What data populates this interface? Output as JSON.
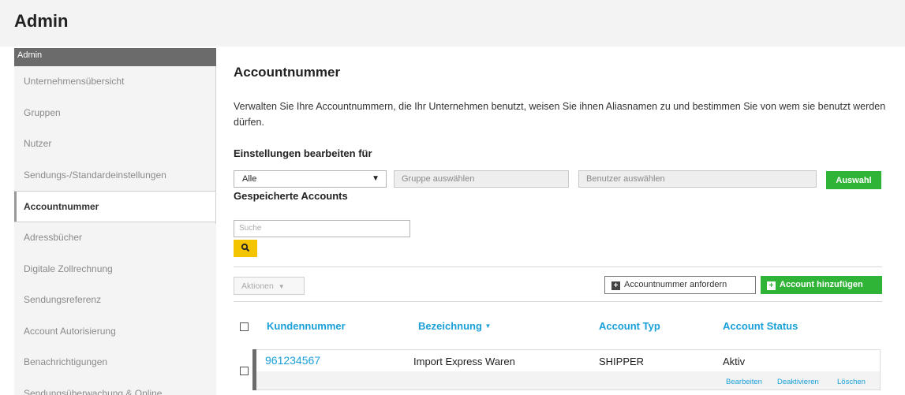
{
  "app": {
    "title": "Admin"
  },
  "sidebar": {
    "header": "Admin",
    "items": [
      {
        "label": "Unternehmensübersicht",
        "active": false
      },
      {
        "label": "Gruppen",
        "active": false
      },
      {
        "label": "Nutzer",
        "active": false
      },
      {
        "label": "Sendungs-/Standardeinstellungen",
        "active": false
      },
      {
        "label": "Accountnummer",
        "active": true
      },
      {
        "label": "Adressbücher",
        "active": false
      },
      {
        "label": "Digitale Zollrechnung",
        "active": false
      },
      {
        "label": "Sendungsreferenz",
        "active": false
      },
      {
        "label": "Account Autorisierung",
        "active": false
      },
      {
        "label": "Benachrichtigungen",
        "active": false
      },
      {
        "label": "Sendungsüberwachung & Online",
        "active": false
      }
    ]
  },
  "main": {
    "title": "Accountnummer",
    "description": "Verwalten Sie Ihre Accountnummern, die Ihr Unternehmen benutzt, weisen Sie ihnen Aliasnamen zu und bestimmen Sie von wem sie benutzt werden dürfen.",
    "settings_label": "Einstellungen bearbeiten für",
    "filter": {
      "scope_value": "Alle",
      "group_placeholder": "Gruppe auswählen",
      "user_placeholder": "Benutzer auswählen",
      "select_button": "Auswahl"
    },
    "saved_label": "Gespeicherte Accounts",
    "search": {
      "placeholder": "Suche"
    },
    "actions_label": "Aktionen",
    "request_button": "Accountnummer anfordern",
    "add_button": "Account hinzufügen",
    "table": {
      "columns": {
        "customer_number": "Kundennummer",
        "designation": "Bezeichnung",
        "account_type": "Account Typ",
        "account_status": "Account Status"
      },
      "rows": [
        {
          "customer_number": "961234567",
          "designation": "Import Express Waren",
          "account_type": "SHIPPER",
          "account_status": "Aktiv",
          "actions": [
            "Bearbeiten",
            "Deaktivieren",
            "Löschen"
          ]
        }
      ]
    }
  },
  "colors": {
    "accent_green": "#2fb437",
    "link_blue": "#1aa0d8",
    "search_yellow": "#f5c400",
    "sidebar_header": "#6b6b6b"
  },
  "icons": {
    "search": "magnifier-icon",
    "add": "plus-square-icon",
    "sort": "sort-down-icon",
    "dropdown": "caret-down-icon"
  }
}
